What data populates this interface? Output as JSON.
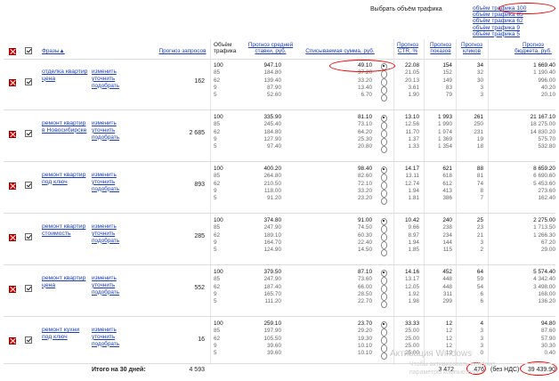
{
  "traffic_selector": {
    "label": "Выбрать объём трафика",
    "options": [
      "объём трафика 100",
      "объём трафика 85",
      "объём трафика 62",
      "объём трафика 9",
      "объём трафика 5"
    ]
  },
  "columns": {
    "phrases": "Фразы▲",
    "forecast_requests": "Прогноз запросов",
    "traffic_volume": "Объём трафика",
    "avg_bid": "Прогноз средней ставки, руб.",
    "spend": "Списываемая сумма, руб.",
    "ctr": "Прогноз CTR, %",
    "impressions": "Прогноз показов",
    "clicks": "Прогноз кликов",
    "budget": "Прогноз бюджета, руб."
  },
  "actions": {
    "change": "изменить",
    "refine": "уточнить",
    "pick": "подобрать"
  },
  "rows": [
    {
      "phrase": "отделка квартир цена",
      "requests": "162",
      "sub": [
        [
          "100",
          "947.10",
          "49.10",
          "22.08",
          "154",
          "34",
          "1 669.40"
        ],
        [
          "85",
          "184.80",
          "37.20",
          "21.05",
          "152",
          "32",
          "1 190.40"
        ],
        [
          "62",
          "139.40",
          "33.20",
          "20.13",
          "149",
          "30",
          "996.00"
        ],
        [
          "9",
          "87.90",
          "13.40",
          "3.61",
          "83",
          "3",
          "40.20"
        ],
        [
          "5",
          "52.60",
          "6.70",
          "1.90",
          "79",
          "3",
          "20.10"
        ]
      ]
    },
    {
      "phrase": "ремонт квартир в Новосибирске",
      "requests": "2 685",
      "sub": [
        [
          "100",
          "335.90",
          "81.10",
          "13.10",
          "1 993",
          "261",
          "21 167.10"
        ],
        [
          "85",
          "245.40",
          "73.10",
          "12.56",
          "1 990",
          "250",
          "18 275.00"
        ],
        [
          "62",
          "184.80",
          "64.20",
          "11.70",
          "1 974",
          "231",
          "14 830.20"
        ],
        [
          "9",
          "127.90",
          "25.30",
          "1.37",
          "1 369",
          "19",
          "575.70"
        ],
        [
          "5",
          "97.40",
          "20.80",
          "1.33",
          "1 354",
          "18",
          "532.80"
        ]
      ]
    },
    {
      "phrase": "ремонт квартир под ключ",
      "requests": "893",
      "sub": [
        [
          "100",
          "400.20",
          "98.40",
          "14.17",
          "621",
          "88",
          "8 659.20"
        ],
        [
          "85",
          "264.80",
          "82.60",
          "13.11",
          "618",
          "81",
          "6 690.60"
        ],
        [
          "62",
          "210.50",
          "72.10",
          "12.74",
          "612",
          "74",
          "5 453.60"
        ],
        [
          "9",
          "118.00",
          "33.20",
          "1.94",
          "413",
          "8",
          "273.60"
        ],
        [
          "5",
          "91.20",
          "23.20",
          "1.81",
          "386",
          "7",
          "162.40"
        ]
      ]
    },
    {
      "phrase": "ремонт квартир стоимость",
      "requests": "285",
      "sub": [
        [
          "100",
          "374.80",
          "91.00",
          "10.42",
          "240",
          "25",
          "2 275.00"
        ],
        [
          "85",
          "247.90",
          "74.50",
          "9.66",
          "238",
          "23",
          "1 713.50"
        ],
        [
          "62",
          "189.10",
          "60.30",
          "8.97",
          "234",
          "21",
          "1 266.30"
        ],
        [
          "9",
          "164.70",
          "22.40",
          "1.94",
          "144",
          "3",
          "67.20"
        ],
        [
          "5",
          "124.90",
          "14.50",
          "1.85",
          "115",
          "2",
          "29.00"
        ]
      ]
    },
    {
      "phrase": "ремонт квартир цена",
      "requests": "552",
      "sub": [
        [
          "100",
          "379.50",
          "87.10",
          "14.16",
          "452",
          "64",
          "5 574.40"
        ],
        [
          "85",
          "247.90",
          "73.60",
          "13.17",
          "448",
          "59",
          "4 342.40"
        ],
        [
          "62",
          "187.40",
          "66.00",
          "12.05",
          "448",
          "54",
          "3 498.00"
        ],
        [
          "9",
          "165.70",
          "28.50",
          "1.92",
          "311",
          "6",
          "168.00"
        ],
        [
          "5",
          "111.20",
          "22.70",
          "1.98",
          "299",
          "6",
          "136.20"
        ]
      ]
    },
    {
      "phrase": "ремонт кухни под ключ",
      "requests": "16",
      "sub": [
        [
          "100",
          "259.10",
          "23.70",
          "33.33",
          "12",
          "4",
          "94.80"
        ],
        [
          "85",
          "197.90",
          "29.20",
          "25.00",
          "12",
          "3",
          "87.60"
        ],
        [
          "62",
          "105.50",
          "19.30",
          "25.00",
          "12",
          "3",
          "57.90"
        ],
        [
          "9",
          "39.60",
          "10.10",
          "25.00",
          "12",
          "3",
          "30.30"
        ],
        [
          "5",
          "39.60",
          "10.10",
          "25.00",
          "12",
          "0",
          "0.40"
        ]
      ]
    }
  ],
  "totals": {
    "label": "Итого на 30 дней:",
    "requests": "4 593",
    "impressions": "3 472",
    "clicks": "476",
    "vat_note": "(без НДС)",
    "budget": "39 439.90"
  },
  "watermark": {
    "title": "Активация Windows",
    "line1": "Чтобы активировать Windows,",
    "line2": "параметры компьютера"
  }
}
